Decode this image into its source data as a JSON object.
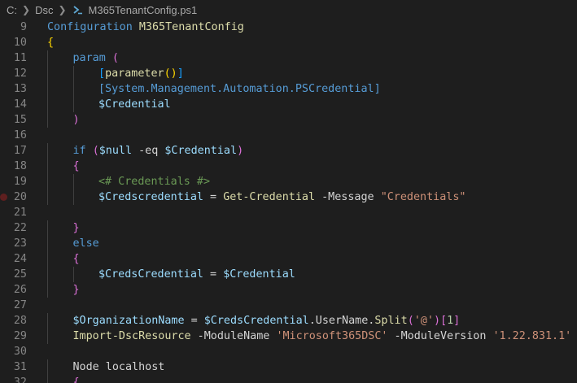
{
  "breadcrumb": {
    "items": [
      "C:",
      "Dsc",
      "M365TenantConfig.ps1"
    ],
    "separator": ">"
  },
  "icons": {
    "file": "powershell-file-icon",
    "breakpoint": "breakpoint-icon"
  },
  "colors": {
    "background": "#1e1e1e",
    "keyword": "#569cd6",
    "function": "#dcdcaa",
    "variable": "#9cdcfe",
    "string": "#ce9178",
    "comment": "#6a9955",
    "bracket_level1": "#ffd700",
    "bracket_level2": "#da70d6",
    "bracket_level3": "#179fff"
  },
  "editor": {
    "breakpoint_line": 20,
    "lines": [
      {
        "number": "9",
        "indent": 0,
        "tokens": [
          [
            "Configuration",
            "kw"
          ],
          [
            " ",
            "plain"
          ],
          [
            "M365TenantConfig",
            "fn"
          ]
        ]
      },
      {
        "number": "10",
        "indent": 0,
        "tokens": [
          [
            "{",
            "brk1"
          ]
        ]
      },
      {
        "number": "11",
        "indent": 1,
        "tokens": [
          [
            "param",
            "kw"
          ],
          [
            " ",
            "plain"
          ],
          [
            "(",
            "brk2"
          ]
        ]
      },
      {
        "number": "12",
        "indent": 2,
        "tokens": [
          [
            "[",
            "brk3"
          ],
          [
            "parameter",
            "fn"
          ],
          [
            "()",
            "brk1"
          ],
          [
            "]",
            "brk3"
          ]
        ]
      },
      {
        "number": "13",
        "indent": 2,
        "tokens": [
          [
            "[System.Management.Automation.PSCredential]",
            "kw"
          ]
        ]
      },
      {
        "number": "14",
        "indent": 2,
        "tokens": [
          [
            "$Credential",
            "var"
          ]
        ]
      },
      {
        "number": "15",
        "indent": 1,
        "tokens": [
          [
            ")",
            "brk2"
          ]
        ]
      },
      {
        "number": "16",
        "indent": 0,
        "tokens": []
      },
      {
        "number": "17",
        "indent": 1,
        "tokens": [
          [
            "if",
            "kw"
          ],
          [
            " ",
            "plain"
          ],
          [
            "(",
            "brk2"
          ],
          [
            "$null",
            "var"
          ],
          [
            " -eq ",
            "plain"
          ],
          [
            "$Credential",
            "var"
          ],
          [
            ")",
            "brk2"
          ]
        ]
      },
      {
        "number": "18",
        "indent": 1,
        "tokens": [
          [
            "{",
            "brk2"
          ]
        ]
      },
      {
        "number": "19",
        "indent": 2,
        "tokens": [
          [
            "<# Credentials #>",
            "cmt"
          ]
        ]
      },
      {
        "number": "20",
        "indent": 2,
        "tokens": [
          [
            "$Credscredential",
            "var"
          ],
          [
            " = ",
            "plain"
          ],
          [
            "Get-Credential",
            "fn"
          ],
          [
            " -Message ",
            "plain"
          ],
          [
            "\"Credentials\"",
            "str"
          ]
        ]
      },
      {
        "number": "21",
        "indent": 0,
        "tokens": []
      },
      {
        "number": "22",
        "indent": 1,
        "tokens": [
          [
            "}",
            "brk2"
          ]
        ]
      },
      {
        "number": "23",
        "indent": 1,
        "tokens": [
          [
            "else",
            "kw"
          ]
        ]
      },
      {
        "number": "24",
        "indent": 1,
        "tokens": [
          [
            "{",
            "brk2"
          ]
        ]
      },
      {
        "number": "25",
        "indent": 2,
        "tokens": [
          [
            "$CredsCredential",
            "var"
          ],
          [
            " = ",
            "plain"
          ],
          [
            "$Credential",
            "var"
          ]
        ]
      },
      {
        "number": "26",
        "indent": 1,
        "tokens": [
          [
            "}",
            "brk2"
          ]
        ]
      },
      {
        "number": "27",
        "indent": 0,
        "tokens": []
      },
      {
        "number": "28",
        "indent": 1,
        "tokens": [
          [
            "$OrganizationName",
            "var"
          ],
          [
            " = ",
            "plain"
          ],
          [
            "$CredsCredential",
            "var"
          ],
          [
            ".UserName.",
            "plain"
          ],
          [
            "Split",
            "fn"
          ],
          [
            "(",
            "brk2"
          ],
          [
            "'@'",
            "str"
          ],
          [
            ")",
            "brk2"
          ],
          [
            "[",
            "brk2"
          ],
          [
            "1",
            "num"
          ],
          [
            "]",
            "brk2"
          ]
        ]
      },
      {
        "number": "29",
        "indent": 1,
        "tokens": [
          [
            "Import-DscResource",
            "fn"
          ],
          [
            " -ModuleName ",
            "plain"
          ],
          [
            "'Microsoft365DSC'",
            "str"
          ],
          [
            " -ModuleVersion ",
            "plain"
          ],
          [
            "'1.22.831.1'",
            "str"
          ]
        ]
      },
      {
        "number": "30",
        "indent": 0,
        "tokens": []
      },
      {
        "number": "31",
        "indent": 1,
        "tokens": [
          [
            "Node localhost",
            "plain"
          ]
        ]
      },
      {
        "number": "32",
        "indent": 1,
        "tokens": [
          [
            "{",
            "brk2"
          ]
        ]
      }
    ]
  }
}
